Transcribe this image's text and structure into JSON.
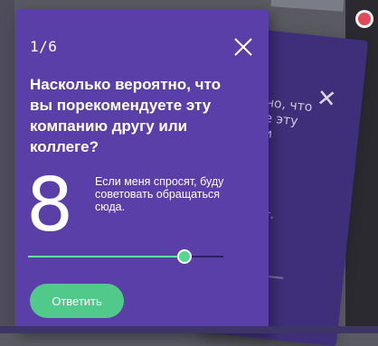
{
  "survey": {
    "counter": "1/6",
    "question": "Насколько вероятно, что вы порекомендуете эту компанию другу или коллеге?",
    "score": "8",
    "score_description": "Если меня спросят, буду советовать обращаться сюда.",
    "slider": {
      "min": 0,
      "max": 10,
      "value": 8
    },
    "submit_label": "Ответить"
  },
  "background_card": {
    "question_fragment": "ятно, что\nете эту\nили",
    "text_fragment": "росят,\nть\nюда."
  },
  "colors": {
    "card": "#5b3fa9",
    "accent": "#51c98a",
    "background_card": "#3f2f7a"
  },
  "icons": {
    "close": "close-icon"
  }
}
